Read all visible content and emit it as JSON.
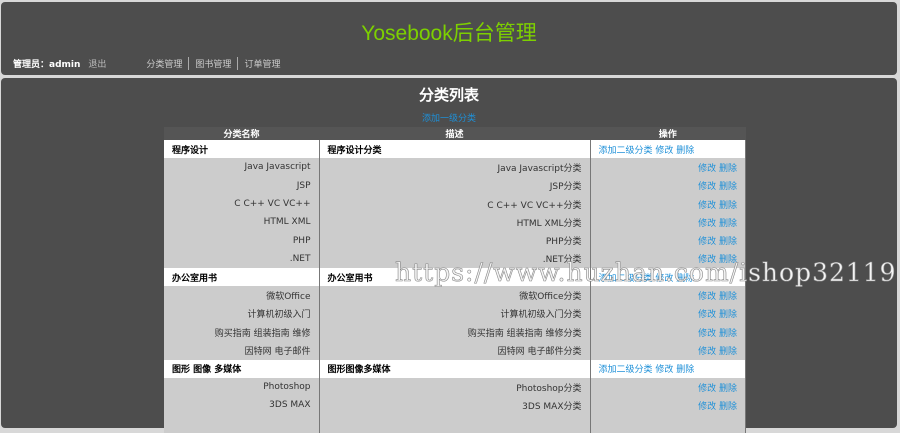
{
  "header": {
    "title": "Yosebook后台管理",
    "admin_label": "管理员：admin",
    "logout": "退出",
    "menu": [
      "分类管理",
      "图书管理",
      "订单管理"
    ]
  },
  "main": {
    "title": "分类列表",
    "add_top": "添加一级分类",
    "columns": [
      "分类名称",
      "描述",
      "操作"
    ],
    "groups": [
      {
        "name": "程序设计",
        "desc": "程序设计分类",
        "children": [
          [
            "Java Javascript",
            "Java Javascript分类"
          ],
          [
            "JSP",
            "JSP分类"
          ],
          [
            "C C++ VC VC++",
            "C C++ VC VC++分类"
          ],
          [
            "HTML XML",
            "HTML XML分类"
          ],
          [
            "PHP",
            "PHP分类"
          ],
          [
            ".NET",
            ".NET分类"
          ]
        ]
      },
      {
        "name": "办公室用书",
        "desc": "办公室用书",
        "children": [
          [
            "微软Office",
            "微软Office分类"
          ],
          [
            "计算机初级入门",
            "计算机初级入门分类"
          ],
          [
            "购买指南 组装指南 维修",
            "购买指南 组装指南 维修分类"
          ],
          [
            "因特网 电子邮件",
            "因特网 电子邮件分类"
          ]
        ]
      },
      {
        "name": "图形 图像 多媒体",
        "desc": "图形图像多媒体",
        "children": [
          [
            "Photoshop",
            "Photoshop分类"
          ],
          [
            "3DS MAX",
            "3DS MAX分类"
          ],
          [
            "",
            ""
          ]
        ]
      }
    ],
    "ops": {
      "add_child": "添加二级分类",
      "edit": "修改",
      "delete": "删除"
    }
  },
  "watermark": "https://www.huzhan.com/ishop32119"
}
